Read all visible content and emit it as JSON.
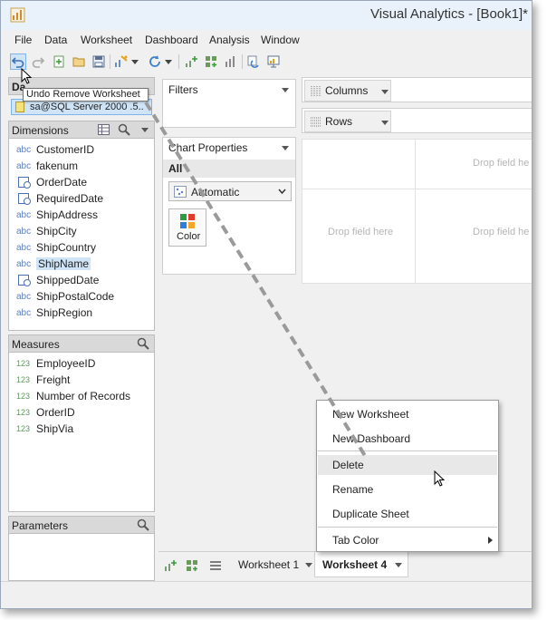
{
  "window": {
    "title": "Visual Analytics - [Book1]*"
  },
  "menu": [
    "File",
    "Data",
    "Worksheet",
    "Dashboard",
    "Analysis",
    "Window"
  ],
  "toolbar": {
    "icons": [
      "undo-icon",
      "redo-icon",
      "new-worksheet-icon",
      "open-icon",
      "save-icon",
      "auto-chart-icon",
      "refresh-icon",
      "add-field-icon",
      "add-measure-icon",
      "chart-sort-icon",
      "filter-icon",
      "presentation-icon"
    ],
    "tooltip": "Undo Remove Worksheet"
  },
  "data_panel": {
    "header": "Da",
    "datasource": "sa@SQL Server 2000 .5.."
  },
  "dimensions": {
    "header": "Dimensions",
    "items": [
      {
        "type": "abc",
        "label": "CustomerID"
      },
      {
        "type": "abc",
        "label": "fakenum"
      },
      {
        "type": "date",
        "label": "OrderDate"
      },
      {
        "type": "date",
        "label": "RequiredDate"
      },
      {
        "type": "abc",
        "label": "ShipAddress"
      },
      {
        "type": "abc",
        "label": "ShipCity"
      },
      {
        "type": "abc",
        "label": "ShipCountry"
      },
      {
        "type": "abc",
        "label": "ShipName"
      },
      {
        "type": "date",
        "label": "ShippedDate"
      },
      {
        "type": "abc",
        "label": "ShipPostalCode"
      },
      {
        "type": "abc",
        "label": "ShipRegion"
      }
    ]
  },
  "measures": {
    "header": "Measures",
    "items": [
      {
        "type": "123",
        "label": "EmployeeID"
      },
      {
        "type": "123",
        "label": "Freight"
      },
      {
        "type": "123",
        "label": "Number of Records"
      },
      {
        "type": "123",
        "label": "OrderID"
      },
      {
        "type": "123",
        "label": "ShipVia"
      }
    ]
  },
  "parameters": {
    "header": "Parameters"
  },
  "filters": {
    "header": "Filters"
  },
  "chart_properties": {
    "header": "Chart Properties",
    "tab": "All",
    "mark_type": "Automatic",
    "color_label": "Color"
  },
  "shelves": {
    "columns": "Columns",
    "rows": "Rows"
  },
  "canvas": {
    "drop_hint": "Drop field here",
    "drop_hint_cut": "Drop field he"
  },
  "sheets": {
    "tab1": "Worksheet 1",
    "tab2": "Worksheet 4"
  },
  "context_menu": {
    "items": [
      "New Worksheet",
      "New Dashboard",
      "Delete",
      "Rename",
      "Duplicate Sheet",
      "Tab Color"
    ]
  },
  "colors": {
    "accent": "#7eb4ea",
    "selection": "#cfe4f7",
    "chrome": "#f0f0f0"
  }
}
